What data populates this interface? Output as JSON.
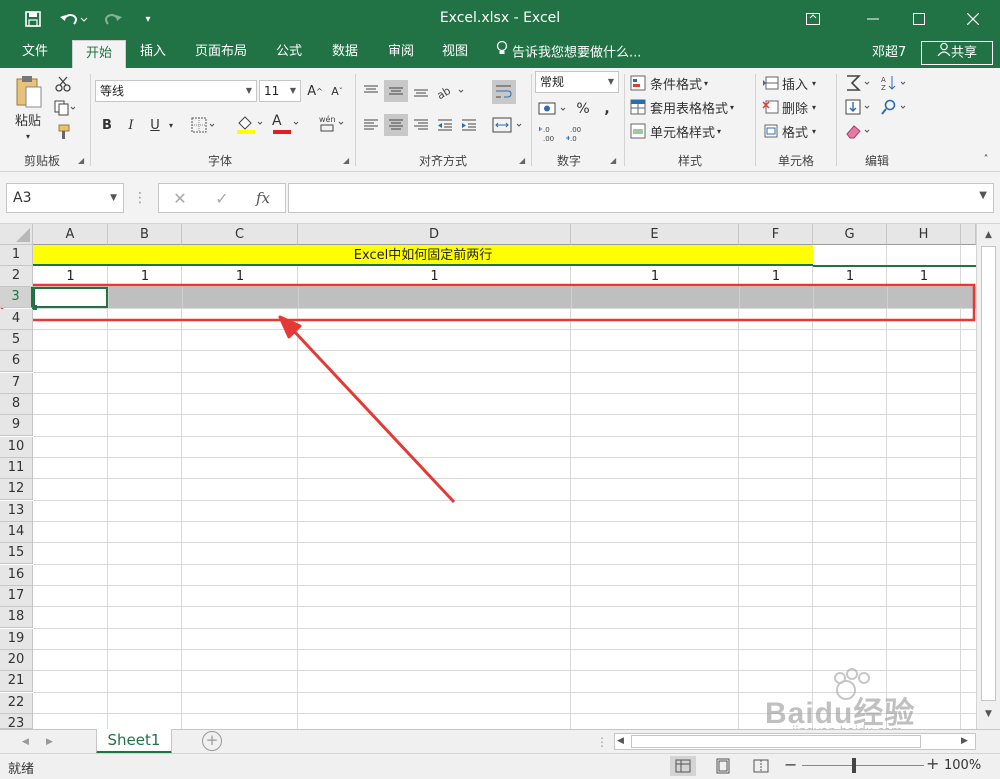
{
  "window": {
    "title": "Excel.xlsx - Excel",
    "save_icon": "save-icon",
    "undo_icon": "undo-icon",
    "redo_icon": "redo-icon",
    "customize_icon": "customize-toolbar-icon"
  },
  "tabs": {
    "items": [
      "文件",
      "开始",
      "插入",
      "页面布局",
      "公式",
      "数据",
      "审阅",
      "视图"
    ],
    "active": "开始",
    "tell_me": "告诉我您想要做什么...",
    "user": "邓超7",
    "share": "共享"
  },
  "ribbon": {
    "clipboard": {
      "paste": "粘贴",
      "label": "剪贴板"
    },
    "font": {
      "name": "等线",
      "size": "11",
      "bold": "B",
      "italic": "I",
      "underline": "U",
      "font_color_letter": "A",
      "label": "字体"
    },
    "alignment": {
      "label": "对齐方式"
    },
    "number": {
      "format": "常规",
      "percent": "%",
      "comma": ",",
      "label": "数字"
    },
    "styles": {
      "conditional": "条件格式",
      "table": "套用表格格式",
      "cell": "单元格样式",
      "label": "样式"
    },
    "cells": {
      "insert": "插入",
      "delete": "删除",
      "format": "格式",
      "label": "单元格"
    },
    "editing": {
      "label": "编辑"
    }
  },
  "formula_bar": {
    "name_box": "A3",
    "fx": "fx",
    "formula": ""
  },
  "sheet": {
    "columns": [
      "A",
      "B",
      "C",
      "D",
      "E",
      "F",
      "G",
      "H"
    ],
    "rows": [
      "1",
      "2",
      "3",
      "4",
      "5",
      "6",
      "7",
      "8",
      "9",
      "10",
      "11",
      "12",
      "13",
      "14",
      "15",
      "16",
      "17",
      "18",
      "19",
      "20",
      "21",
      "22",
      "23"
    ],
    "title_cell": "Excel中如何固定前两行",
    "row2_values": [
      "1",
      "1",
      "1",
      "1",
      "1",
      "1",
      "1",
      "1"
    ],
    "selected_row": "3",
    "selected_cell": "A3",
    "title_fill_color": "#ffff00",
    "selection_fill_color": "#bfbfbf"
  },
  "sheet_tabs": {
    "active": "Sheet1",
    "add_icon": "add-sheet-icon"
  },
  "status": {
    "ready": "就绪",
    "zoom": "100%",
    "zoom_level": 1.0
  },
  "annotation": {
    "color": "#e53935",
    "watermark": "Baidu经验",
    "watermark_url": "jingyan.baidu.com"
  }
}
